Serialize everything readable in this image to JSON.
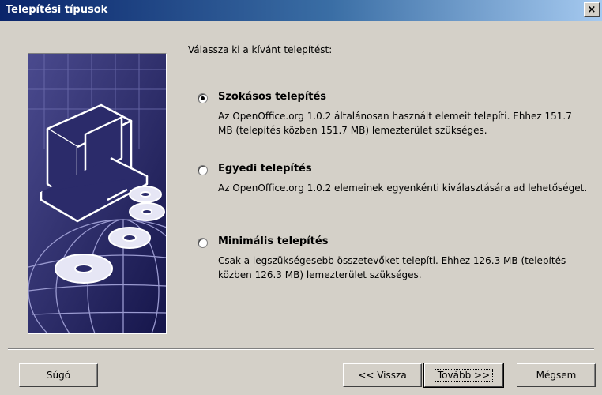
{
  "window": {
    "title": "Telepítési típusok",
    "close_label": "×"
  },
  "heading": "Válassza ki a kívánt telepítést:",
  "options": [
    {
      "title": "Szokásos telepítés",
      "description": "Az OpenOffice.org 1.0.2 általánosan használt elemeit telepíti. Ehhez 151.7 MB (telepítés közben 151.7 MB)  lemezterület szükséges.",
      "selected": true
    },
    {
      "title": "Egyedi telepítés",
      "description": "Az OpenOffice.org 1.0.2 elemeinek egyenkénti kiválasztására ad lehetőséget.",
      "selected": false
    },
    {
      "title": "Minimális telepítés",
      "description": "Csak a legszükségesebb összetevőket telepíti. Ehhez 126.3 MB (telepítés közben 126.3 MB) lemezterület szükséges.",
      "selected": false
    }
  ],
  "buttons": {
    "help": "Súgó",
    "back": "<< Vissza",
    "next": "Tovább >>",
    "cancel": "Mégsem"
  },
  "icons": {
    "artwork": "computer-cd-globe-artwork"
  }
}
